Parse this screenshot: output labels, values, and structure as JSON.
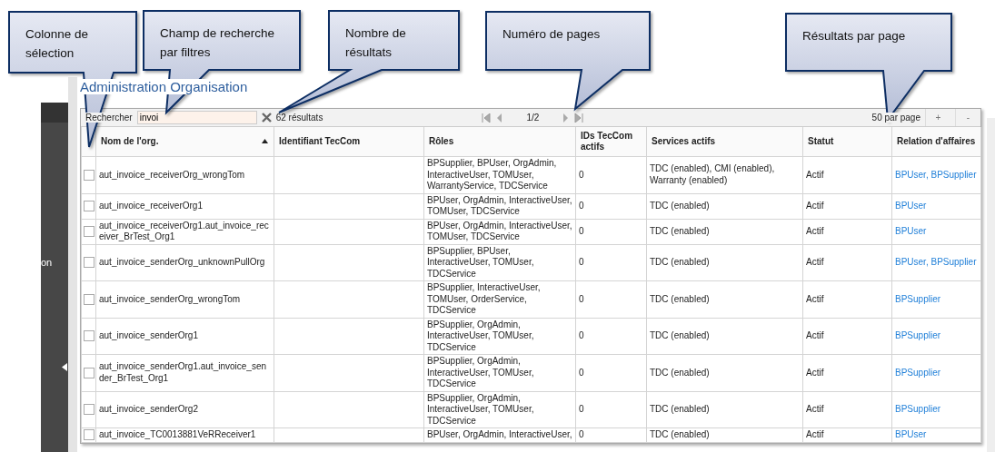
{
  "callouts": [
    {
      "text": "Colonne de sélection"
    },
    {
      "text": "Champ de recherche par filtres"
    },
    {
      "text": "Nombre de résultats"
    },
    {
      "text": "Numéro de pages"
    },
    {
      "text": "Résultats par page"
    }
  ],
  "sidebar": {
    "label": "on"
  },
  "page_title": "Administration Organisation",
  "toolbar": {
    "search_label": "Rechercher",
    "search_value": "invoi",
    "result_count": "62 résultats",
    "page": "1/2",
    "per_page": "50 par page",
    "add": "+",
    "remove": "-"
  },
  "table": {
    "columns": [
      {
        "label": "Nom de l'org.",
        "sorted": true
      },
      {
        "label": "Identifiant TecCom",
        "sorted": false
      },
      {
        "label": "Rôles",
        "sorted": false
      },
      {
        "label": "IDs TecCom actifs",
        "sorted": false
      },
      {
        "label": "Services actifs",
        "sorted": false
      },
      {
        "label": "Statut",
        "sorted": false
      },
      {
        "label": "Relation d'affaires",
        "sorted": false
      }
    ],
    "rows": [
      {
        "checked": false,
        "name": "aut_invoice_receiverOrg_wrongTom",
        "teccom_id": "",
        "roles": "BPSupplier, BPUser, OrgAdmin, InteractiveUser, TOMUser, WarrantyService, TDCService",
        "ids": "0",
        "services": "TDC (enabled), CMI (enabled), Warranty (enabled)",
        "status": "Actif",
        "relation": "BPUser, BPSupplier"
      },
      {
        "checked": false,
        "name": "aut_invoice_receiverOrg1",
        "teccom_id": "",
        "roles": "BPUser, OrgAdmin, InteractiveUser, TOMUser, TDCService",
        "ids": "0",
        "services": "TDC (enabled)",
        "status": "Actif",
        "relation": "BPUser"
      },
      {
        "checked": false,
        "name": "aut_invoice_receiverOrg1.aut_invoice_receiver_BrTest_Org1",
        "teccom_id": "",
        "roles": "BPUser, OrgAdmin, InteractiveUser, TOMUser, TDCService",
        "ids": "0",
        "services": "TDC (enabled)",
        "status": "Actif",
        "relation": "BPUser"
      },
      {
        "checked": false,
        "name": "aut_invoice_senderOrg_unknownPullOrg",
        "teccom_id": "",
        "roles": "BPSupplier, BPUser, InteractiveUser, TOMUser, TDCService",
        "ids": "0",
        "services": "TDC (enabled)",
        "status": "Actif",
        "relation": "BPUser, BPSupplier"
      },
      {
        "checked": false,
        "name": "aut_invoice_senderOrg_wrongTom",
        "teccom_id": "",
        "roles": "BPSupplier, InteractiveUser, TOMUser, OrderService, TDCService",
        "ids": "0",
        "services": "TDC (enabled)",
        "status": "Actif",
        "relation": "BPSupplier"
      },
      {
        "checked": false,
        "name": "aut_invoice_senderOrg1",
        "teccom_id": "",
        "roles": "BPSupplier, OrgAdmin, InteractiveUser, TOMUser, TDCService",
        "ids": "0",
        "services": "TDC (enabled)",
        "status": "Actif",
        "relation": "BPSupplier"
      },
      {
        "checked": false,
        "name": "aut_invoice_senderOrg1.aut_invoice_sender_BrTest_Org1",
        "teccom_id": "",
        "roles": "BPSupplier, OrgAdmin, InteractiveUser, TOMUser, TDCService",
        "ids": "0",
        "services": "TDC (enabled)",
        "status": "Actif",
        "relation": "BPSupplier"
      },
      {
        "checked": false,
        "name": "aut_invoice_senderOrg2",
        "teccom_id": "",
        "roles": "BPSupplier, OrgAdmin, InteractiveUser, TOMUser, TDCService",
        "ids": "0",
        "services": "TDC (enabled)",
        "status": "Actif",
        "relation": "BPSupplier"
      },
      {
        "checked": false,
        "name": "aut_invoice_TC0013881VeRReceiver1",
        "teccom_id": "",
        "roles": "BPUser, OrgAdmin, InteractiveUser,",
        "ids": "0",
        "services": "TDC (enabled)",
        "status": "Actif",
        "relation": "BPUser"
      }
    ]
  }
}
